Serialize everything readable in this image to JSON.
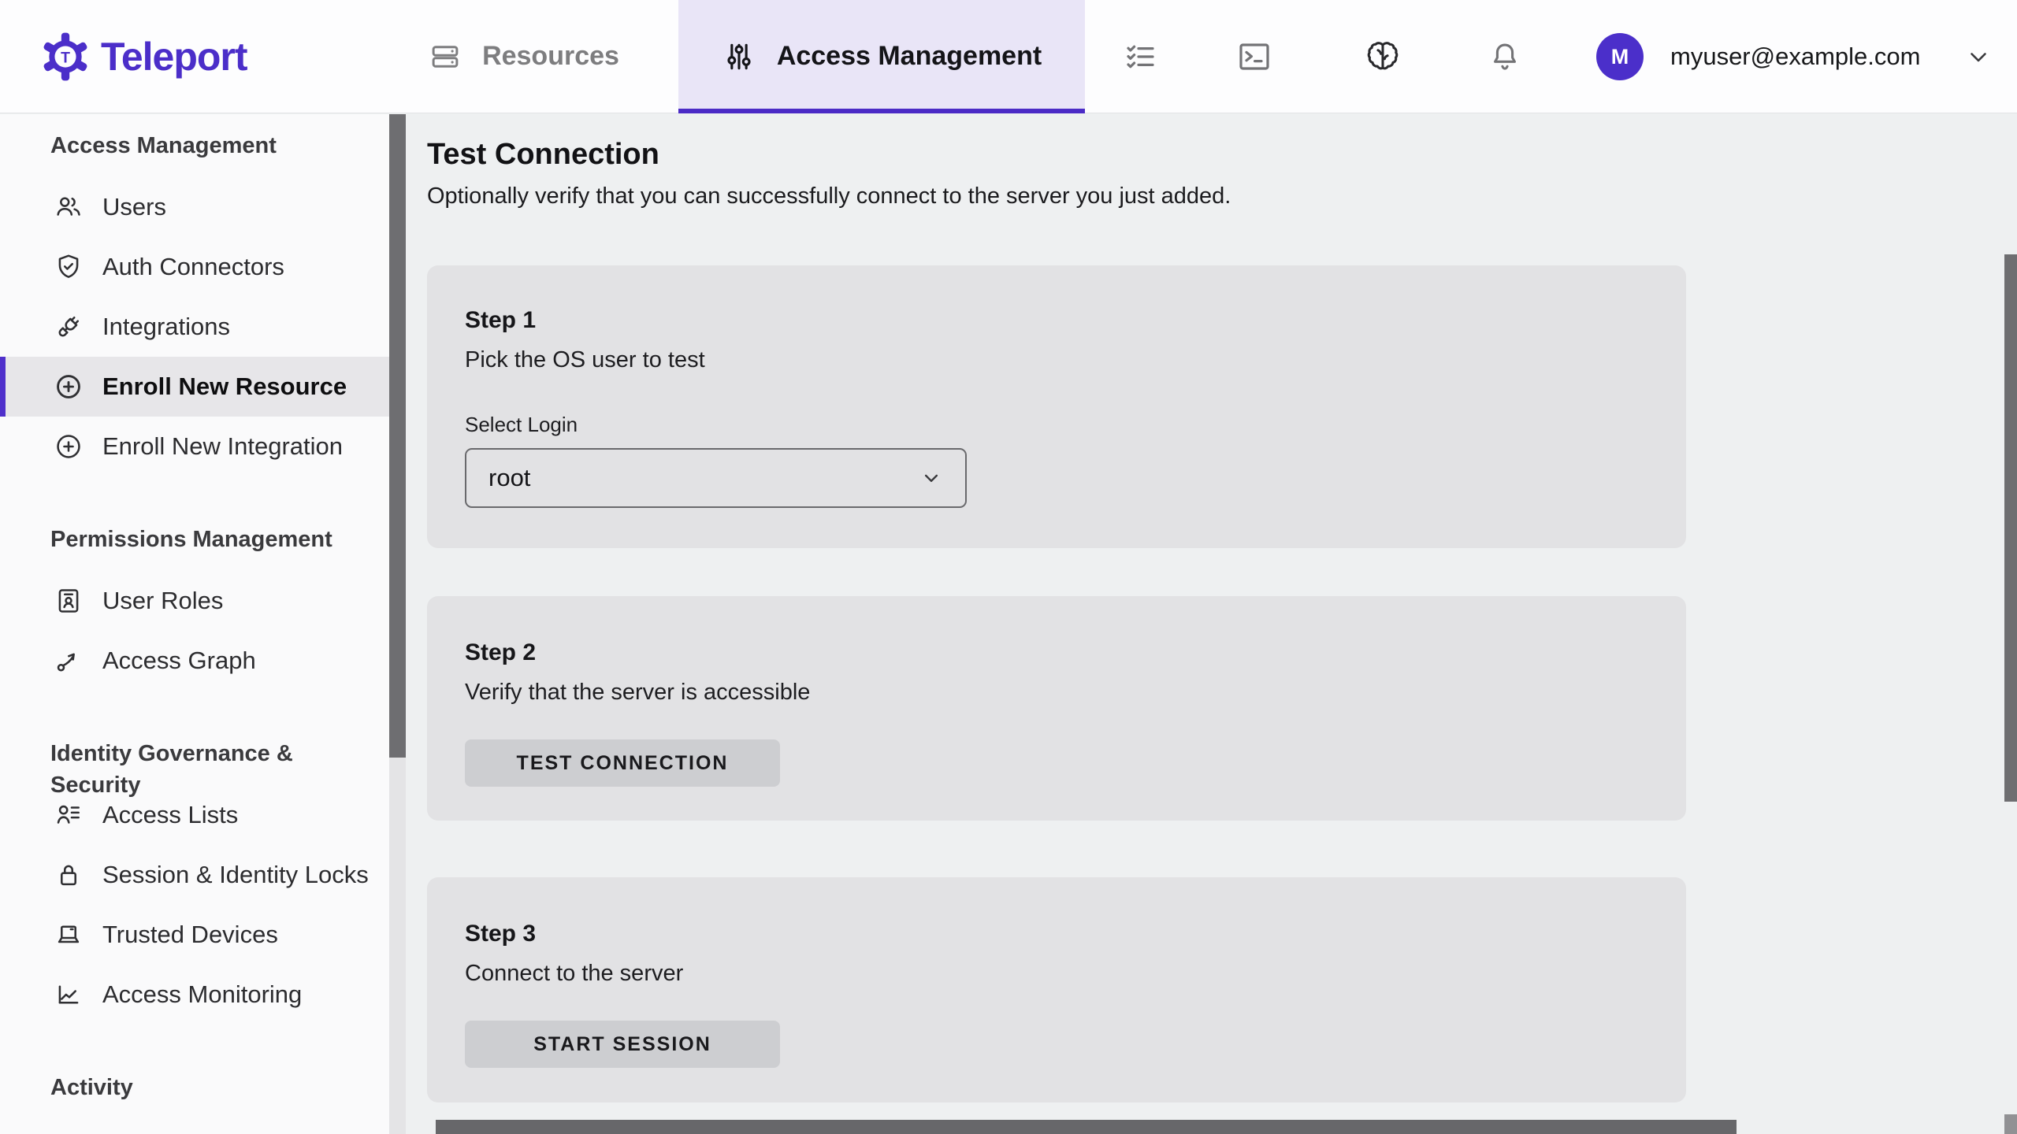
{
  "brand": {
    "name": "Teleport",
    "initial": "T"
  },
  "colors": {
    "brand_purple": "#4b2ec9",
    "active_tab_bg": "#e9e5f7",
    "tab_underline": "#4b2bc6",
    "sidebar_bg": "#fafafb",
    "sidebar_active_bg": "#e7e6e9",
    "main_bg": "#eef0f1",
    "card_bg": "#e2e2e4",
    "button_bg": "#cdced1",
    "terminal_bar": "#67676a",
    "scrollbar_thumb": "#6e6e71",
    "avatar_bg": "#4b2fca"
  },
  "topnav": {
    "tabs": [
      {
        "label": "Resources",
        "icon": "server-stack-icon",
        "active": false
      },
      {
        "label": "Access Management",
        "icon": "sliders-icon",
        "active": true
      }
    ],
    "action_icons": [
      "checklist-icon",
      "terminal-icon",
      "brain-icon",
      "bell-icon"
    ],
    "user": {
      "initial": "M",
      "email": "myuser@example.com",
      "menu_icon": "chevron-down-icon"
    }
  },
  "sidebar": {
    "sections": [
      {
        "title": "Access Management",
        "items": [
          {
            "label": "Users",
            "icon": "users-icon",
            "active": false
          },
          {
            "label": "Auth Connectors",
            "icon": "shield-check-icon",
            "active": false
          },
          {
            "label": "Integrations",
            "icon": "plug-icon",
            "active": false
          },
          {
            "label": "Enroll New Resource",
            "icon": "plus-circle-icon",
            "active": true
          },
          {
            "label": "Enroll New Integration",
            "icon": "plus-circle-icon",
            "active": false
          }
        ]
      },
      {
        "title": "Permissions Management",
        "items": [
          {
            "label": "User Roles",
            "icon": "id-card-icon",
            "active": false
          },
          {
            "label": "Access Graph",
            "icon": "graph-arrow-icon",
            "active": false
          }
        ]
      },
      {
        "title": "Identity Governance & Security",
        "items": [
          {
            "label": "Access Lists",
            "icon": "person-list-icon",
            "active": false
          },
          {
            "label": "Session & Identity Locks",
            "icon": "lock-icon",
            "active": false
          },
          {
            "label": "Trusted Devices",
            "icon": "laptop-icon",
            "active": false
          },
          {
            "label": "Access Monitoring",
            "icon": "chart-line-icon",
            "active": false
          }
        ]
      },
      {
        "title": "Activity",
        "items": []
      }
    ]
  },
  "main": {
    "title": "Test Connection",
    "subtitle": "Optionally verify that you can successfully connect to the server you just added.",
    "steps": [
      {
        "title": "Step 1",
        "description": "Pick the OS user to test",
        "select_label": "Select Login",
        "select_value": "root"
      },
      {
        "title": "Step 2",
        "description": "Verify that the server is accessible",
        "button": "TEST CONNECTION"
      },
      {
        "title": "Step 3",
        "description": "Connect to the server",
        "button": "START SESSION"
      }
    ]
  }
}
